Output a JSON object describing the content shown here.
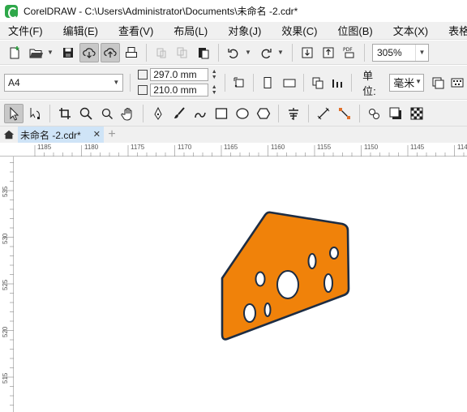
{
  "window": {
    "title": "CorelDRAW - C:\\Users\\Administrator\\Documents\\未命名 -2.cdr*"
  },
  "menu": {
    "items": [
      "文件(F)",
      "编辑(E)",
      "查看(V)",
      "布局(L)",
      "对象(J)",
      "效果(C)",
      "位图(B)",
      "文本(X)",
      "表格(T)"
    ]
  },
  "toolbar": {
    "zoom": "305%"
  },
  "property_bar": {
    "page_preset": "A4",
    "width": "297.0 mm",
    "height": "210.0 mm",
    "units_label": "单位:",
    "units_value": "毫米"
  },
  "tabs": {
    "document": "未命名 -2.cdr*"
  },
  "ruler": {
    "h_labels": [
      "1185",
      "1180",
      "1175",
      "1170",
      "1165",
      "1160",
      "1155",
      "1150",
      "1145",
      "114"
    ],
    "v_labels": [
      "535",
      "530",
      "525",
      "520",
      "515"
    ]
  },
  "icons": {
    "app": "coreldraw-logo",
    "pdf": "PDF"
  },
  "colors": {
    "cheese_fill": "#f0820a",
    "cheese_outline": "#1d2d44",
    "tab_active": "#cfe4f7"
  }
}
